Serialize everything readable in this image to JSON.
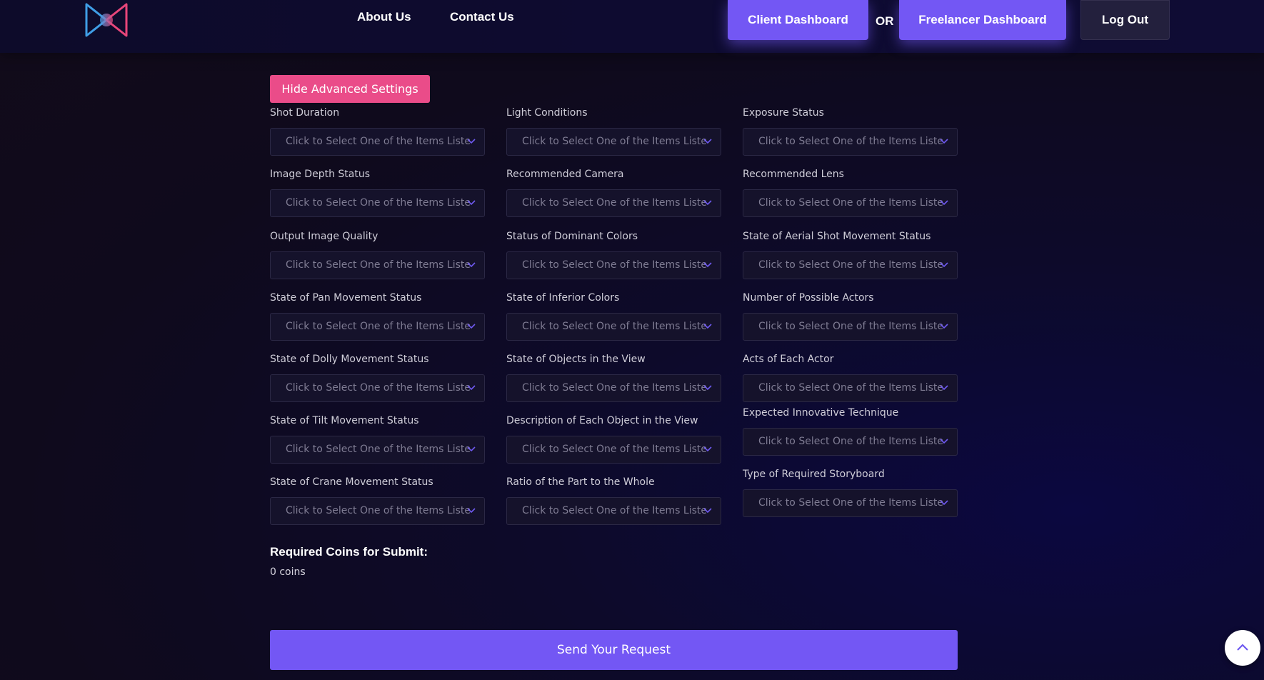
{
  "header": {
    "nav": [
      "About Us",
      "Contact Us"
    ],
    "client_dashboard": "Client Dashboard",
    "or_text": "OR",
    "freelancer_dashboard": "Freelancer Dashboard",
    "logout": "Log Out"
  },
  "advanced_button": "Hide Advanced Settings",
  "select_placeholder": "Click to Select One of the Items Listed",
  "fields": {
    "c1": [
      "Shot Duration",
      "Image Depth Status",
      "Output Image Quality",
      "State of Pan Movement Status",
      "State of Dolly Movement Status",
      "State of Tilt Movement Status",
      "State of Crane Movement Status"
    ],
    "c2": [
      "Light Conditions",
      "Recommended Camera",
      "Status of Dominant Colors",
      "State of Inferior Colors",
      "State of Objects in the View",
      "Description of Each Object in the View",
      "Ratio of the Part to the Whole"
    ],
    "c3": [
      "Exposure Status",
      "Recommended Lens",
      "State of Aerial Shot Movement Status",
      "Number of Possible Actors",
      "Acts of Each Actor",
      "Expected Innovative Technique",
      "Type of Required Storyboard"
    ]
  },
  "coins": {
    "title": "Required Coins for Submit:",
    "value": "0 coins"
  },
  "submit": "Send Your Request",
  "colors": {
    "accent": "#7357f4",
    "pink": "#ea4c89",
    "background": "#0f0a1c"
  }
}
